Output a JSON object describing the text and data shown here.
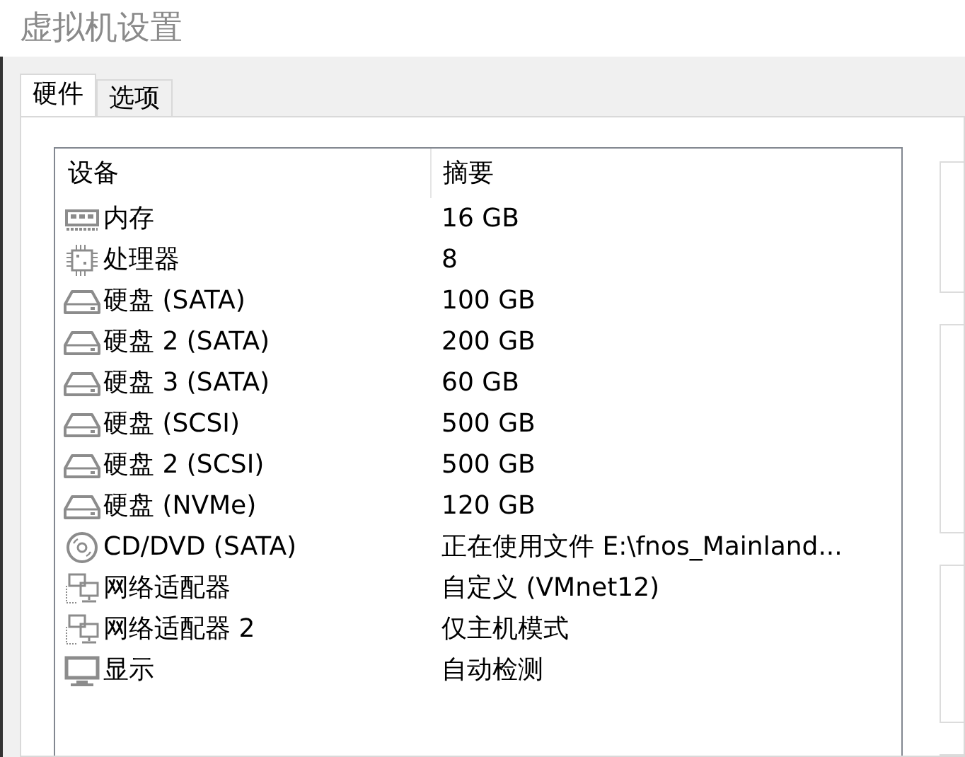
{
  "window": {
    "title": "虚拟机设置"
  },
  "tabs": [
    {
      "label": "硬件",
      "selected": true
    },
    {
      "label": "选项",
      "selected": false
    }
  ],
  "device_list": {
    "columns": [
      "设备",
      "摘要"
    ],
    "rows": [
      {
        "kind": "memory",
        "device": "内存",
        "summary": "16 GB"
      },
      {
        "kind": "cpu",
        "device": "处理器",
        "summary": "8"
      },
      {
        "kind": "disk",
        "device": "硬盘 (SATA)",
        "summary": "100 GB"
      },
      {
        "kind": "disk",
        "device": "硬盘 2 (SATA)",
        "summary": "200 GB"
      },
      {
        "kind": "disk",
        "device": "硬盘 3 (SATA)",
        "summary": "60 GB"
      },
      {
        "kind": "disk",
        "device": "硬盘 (SCSI)",
        "summary": "500 GB"
      },
      {
        "kind": "disk",
        "device": "硬盘 2 (SCSI)",
        "summary": "500 GB"
      },
      {
        "kind": "disk",
        "device": "硬盘 (NVMe)",
        "summary": "120 GB"
      },
      {
        "kind": "cdrom",
        "device": "CD/DVD (SATA)",
        "summary": "正在使用文件 E:\\fnos_Mainland..."
      },
      {
        "kind": "network",
        "device": "网络适配器",
        "summary": "自定义 (VMnet12)"
      },
      {
        "kind": "network",
        "device": "网络适配器 2",
        "summary": "仅主机模式"
      },
      {
        "kind": "display",
        "device": "显示",
        "summary": "自动检测"
      }
    ]
  }
}
